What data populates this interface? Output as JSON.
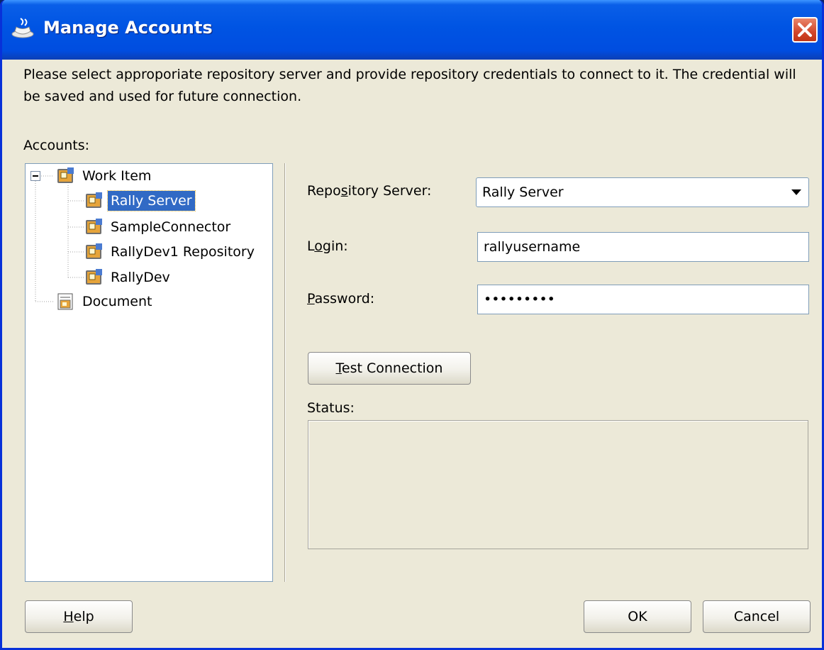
{
  "window": {
    "title": "Manage Accounts"
  },
  "description": "Please select approporiate repository server and provide repository credentials to connect to it. The credential will be saved and used for future connection.",
  "accounts_label": "Accounts:",
  "tree": [
    {
      "label": "Work Item",
      "expanded": true,
      "children": [
        {
          "label": "Rally Server",
          "selected": true
        },
        {
          "label": "SampleConnector"
        },
        {
          "label": "RallyDev1 Repository"
        },
        {
          "label": "RallyDev"
        }
      ]
    },
    {
      "label": "Document"
    }
  ],
  "form": {
    "repository_server": {
      "label_pre": "Repo",
      "label_u": "s",
      "label_post": "itory Server:",
      "value": "Rally Server"
    },
    "login": {
      "label_pre": "L",
      "label_u": "o",
      "label_post": "gin:",
      "value": "rallyusername"
    },
    "password": {
      "label_pre": "",
      "label_u": "P",
      "label_post": "assword:",
      "value": "•••••••••"
    },
    "test_connection": {
      "label_u": "T",
      "label_post": "est Connection"
    },
    "status_label": "Status:"
  },
  "buttons": {
    "help": {
      "label_u": "H",
      "label_post": "elp"
    },
    "ok": "OK",
    "cancel": "Cancel"
  },
  "colors": {
    "title_bar": "#0054e3",
    "selection": "#316ac5",
    "dialog_bg": "#ece9d8"
  }
}
